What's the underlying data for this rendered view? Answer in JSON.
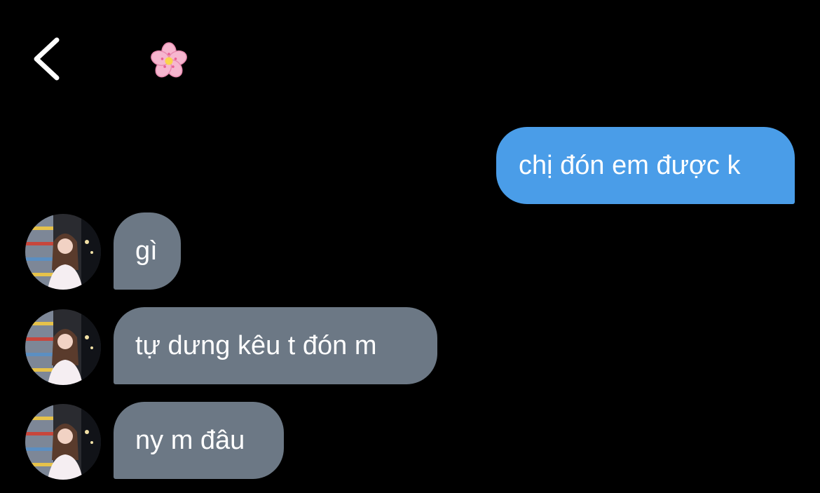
{
  "header": {
    "back_icon": "chevron-left-icon",
    "contact_icon": "cherry-blossom-icon"
  },
  "messages": [
    {
      "direction": "sent",
      "text": "chị đón em được k"
    },
    {
      "direction": "received",
      "text": "gì"
    },
    {
      "direction": "received",
      "text": "tự dưng kêu t đón m"
    },
    {
      "direction": "received",
      "text": "ny m đâu"
    }
  ],
  "colors": {
    "background": "#000000",
    "sent_bubble": "#4a9de8",
    "received_bubble": "#6c7885",
    "text": "#ffffff"
  }
}
